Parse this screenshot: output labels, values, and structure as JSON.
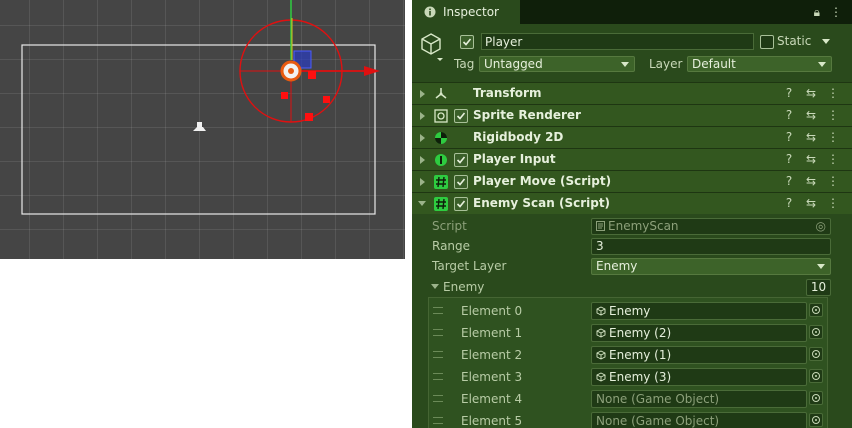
{
  "inspector": {
    "tab_label": "Inspector",
    "header": {
      "name": "Player",
      "static_label": "Static",
      "tag_label": "Tag",
      "tag_value": "Untagged",
      "layer_label": "Layer",
      "layer_value": "Default"
    },
    "components": [
      {
        "name": "Transform",
        "has_checkbox": false
      },
      {
        "name": "Sprite Renderer",
        "has_checkbox": true
      },
      {
        "name": "Rigidbody 2D",
        "has_checkbox": false
      },
      {
        "name": "Player Input",
        "has_checkbox": true
      },
      {
        "name": "Player Move (Script)",
        "has_checkbox": true
      },
      {
        "name": "Enemy Scan (Script)",
        "has_checkbox": true
      }
    ],
    "enemy_scan": {
      "script_label": "Script",
      "script_value": "EnemyScan",
      "range_label": "Range",
      "range_value": "3",
      "target_layer_label": "Target Layer",
      "target_layer_value": "Enemy",
      "enemy_label": "Enemy",
      "enemy_count": "10",
      "elements": [
        {
          "label": "Element 0",
          "value": "Enemy",
          "assigned": true
        },
        {
          "label": "Element 1",
          "value": "Enemy (2)",
          "assigned": true
        },
        {
          "label": "Element 2",
          "value": "Enemy (1)",
          "assigned": true
        },
        {
          "label": "Element 3",
          "value": "Enemy (3)",
          "assigned": true
        },
        {
          "label": "Element 4",
          "value": "None (Game Object)",
          "assigned": false
        },
        {
          "label": "Element 5",
          "value": "None (Game Object)",
          "assigned": false
        }
      ]
    }
  },
  "colors": {
    "scene_bg": "#454545",
    "inspector_bg": "#2a4a1c",
    "gizmo_red": "#e01010",
    "gizmo_green": "#2ecc40"
  }
}
